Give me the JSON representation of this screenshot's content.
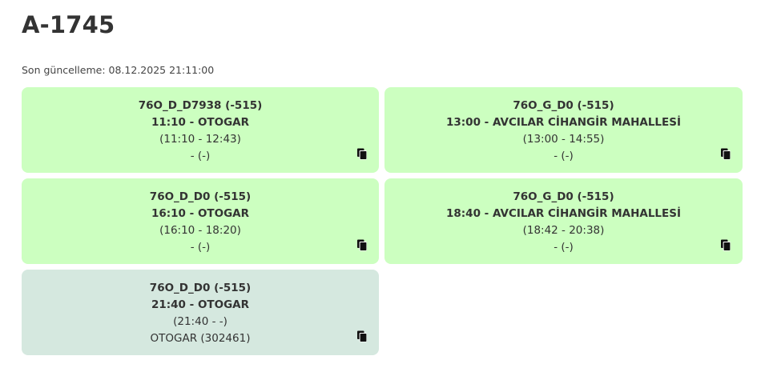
{
  "page": {
    "title": "A-1745",
    "last_update_label": "Son güncelleme:",
    "last_update_value": "08.12.2025 21:11:00"
  },
  "trips": [
    {
      "route": "76O_D_D7938 (-515)",
      "departure": "11:10 - OTOGAR",
      "times": "(11:10 - 12:43)",
      "stop": "- (-)",
      "status": "active"
    },
    {
      "route": "76O_G_D0 (-515)",
      "departure": "13:00 - AVCILAR CİHANGİR MAHALLESİ",
      "times": "(13:00 - 14:55)",
      "stop": "- (-)",
      "status": "active"
    },
    {
      "route": "76O_D_D0 (-515)",
      "departure": "16:10 - OTOGAR",
      "times": "(16:10 - 18:20)",
      "stop": "- (-)",
      "status": "active"
    },
    {
      "route": "76O_G_D0 (-515)",
      "departure": "18:40 - AVCILAR CİHANGİR MAHALLESİ",
      "times": "(18:42 - 20:38)",
      "stop": "- (-)",
      "status": "active"
    },
    {
      "route": "76O_D_D0 (-515)",
      "departure": "21:40 - OTOGAR",
      "times": "(21:40 - -)",
      "stop": "OTOGAR (302461)",
      "status": "current"
    }
  ],
  "colors": {
    "card_active": "#ccffc0",
    "card_current": "#d5e8df",
    "text": "#333333"
  },
  "icons": {
    "copy": "copy-icon"
  }
}
